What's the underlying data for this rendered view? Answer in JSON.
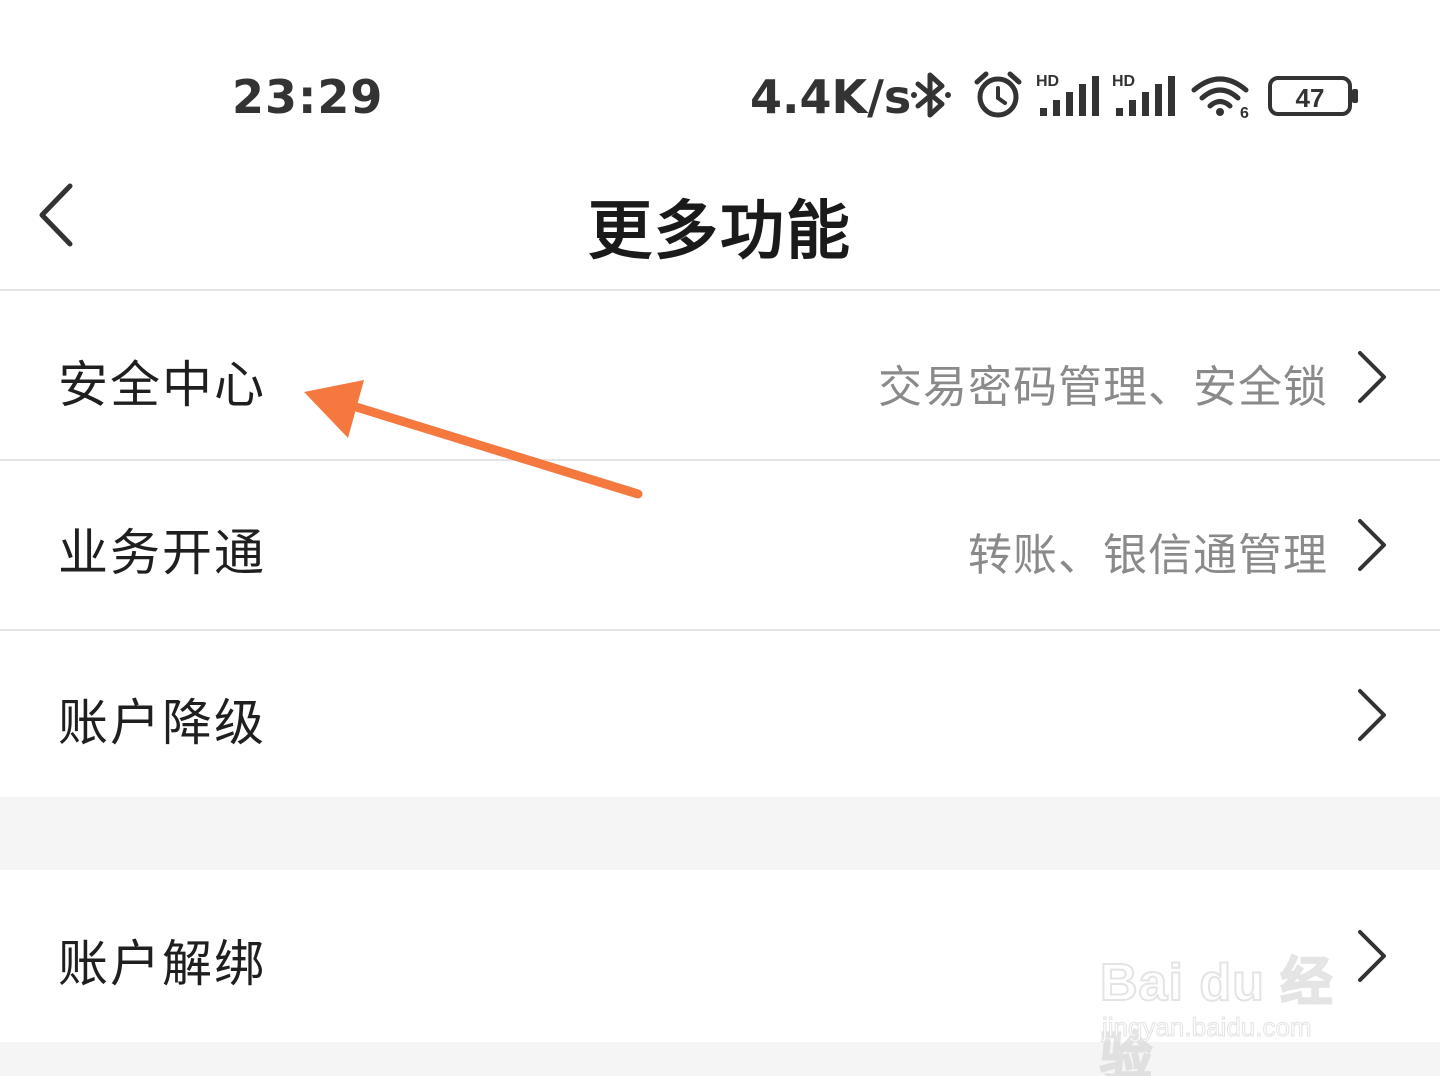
{
  "status_bar": {
    "time": "23:29",
    "net_speed": "4.4K/s",
    "icons": [
      "bluetooth-icon",
      "alarm-icon",
      "signal-hd-icon",
      "signal-hd-icon",
      "wifi-icon",
      "battery-icon"
    ],
    "signal_label_1": "HD",
    "signal_label_2": "HD",
    "wifi_label": "6",
    "battery_level": "47"
  },
  "header": {
    "back_icon": "back-arrow-icon",
    "title": "更多功能"
  },
  "menu": {
    "items": [
      {
        "label": "安全中心",
        "subtitle": "交易密码管理、安全锁"
      },
      {
        "label": "业务开通",
        "subtitle": "转账、银信通管理"
      },
      {
        "label": "账户降级",
        "subtitle": ""
      }
    ],
    "items2": [
      {
        "label": "账户解绑",
        "subtitle": ""
      }
    ]
  },
  "annotation": {
    "color": "#f5793f"
  },
  "watermark": {
    "main": "Bai du 经验",
    "url": "jingyan.baidu.com"
  },
  "colors": {
    "divider": "#e4e4e4",
    "section_gap": "#f5f5f5",
    "subtitle": "#8a8a8a"
  }
}
